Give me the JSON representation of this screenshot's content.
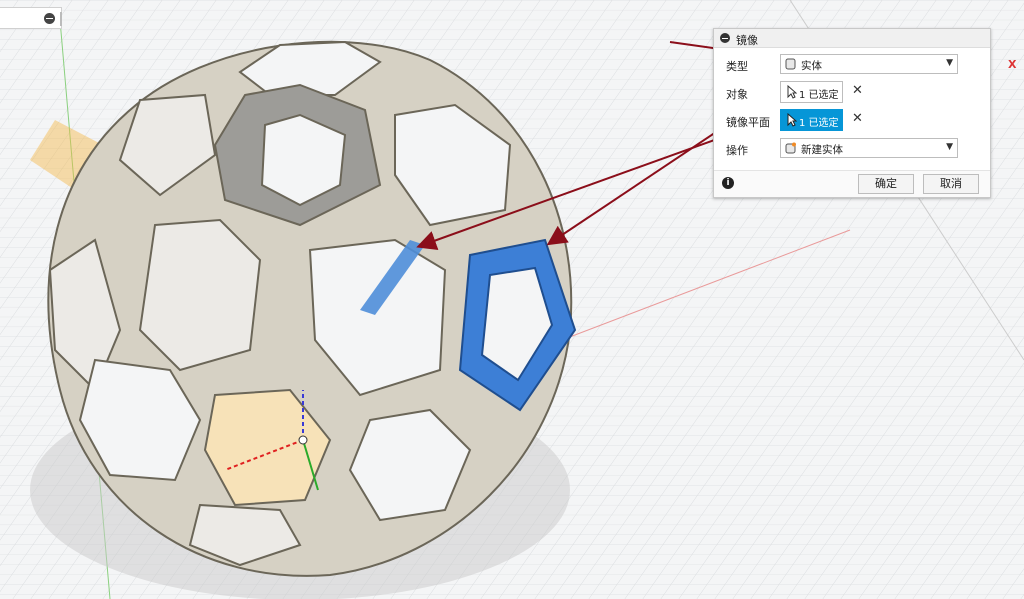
{
  "dialog": {
    "title": "镜像",
    "rows": {
      "type": {
        "label": "类型",
        "value": "实体",
        "icon": "solid-body-icon"
      },
      "objects": {
        "label": "对象",
        "value": "1 已选定",
        "icon": "cursor-arrow-icon"
      },
      "mirror_plane": {
        "label": "镜像平面",
        "value": "1 已选定",
        "icon": "cursor-arrow-icon"
      },
      "operation": {
        "label": "操作",
        "value": "新建实体",
        "icon": "new-body-icon"
      }
    },
    "ok_label": "确定",
    "cancel_label": "取消"
  },
  "viewcube": {
    "axis_label": "X"
  },
  "colors": {
    "accent_selected": "#0696d7",
    "selected_face": "#3d7fd6",
    "annotation_arrow": "#8b0e1a",
    "plane_highlight": "#f5b748",
    "model_body": "#d6d1c4"
  }
}
